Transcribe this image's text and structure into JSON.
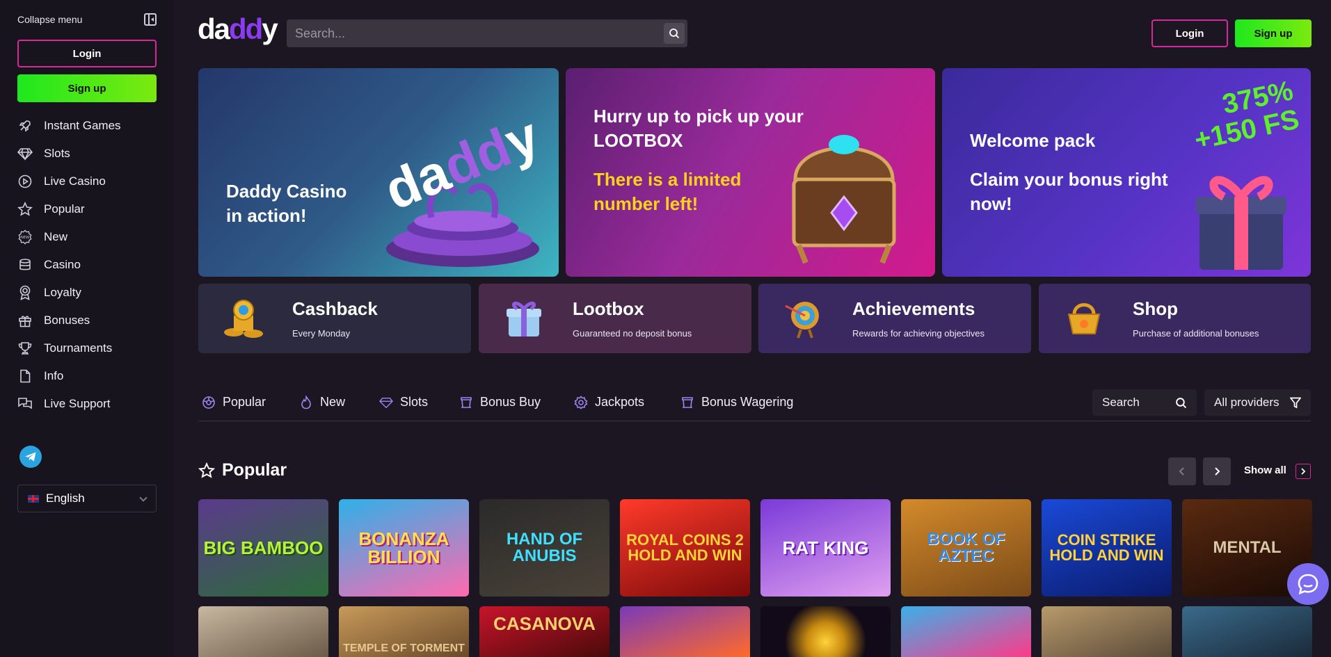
{
  "sidebar": {
    "collapse_label": "Collapse menu",
    "login": "Login",
    "signup": "Sign up",
    "items": [
      {
        "label": "Instant Games",
        "icon": "rocket-icon"
      },
      {
        "label": "Slots",
        "icon": "diamond-icon"
      },
      {
        "label": "Live Casino",
        "icon": "play-icon"
      },
      {
        "label": "Popular",
        "icon": "star-icon"
      },
      {
        "label": "New",
        "icon": "new-badge-icon"
      },
      {
        "label": "Casino",
        "icon": "database-icon"
      },
      {
        "label": "Loyalty",
        "icon": "award-icon"
      },
      {
        "label": "Bonuses",
        "icon": "gift-icon"
      },
      {
        "label": "Tournaments",
        "icon": "trophy-icon"
      },
      {
        "label": "Info",
        "icon": "document-icon"
      },
      {
        "label": "Live Support",
        "icon": "chat-icon"
      }
    ],
    "language": "English"
  },
  "header": {
    "logo": {
      "part1": "da",
      "part2": "dd",
      "part3": "y"
    },
    "search_placeholder": "Search...",
    "login": "Login",
    "signup": "Sign up"
  },
  "banners": [
    {
      "title": "Daddy Casino in action!"
    },
    {
      "title": "Hurry up to pick up your LOOTBOX",
      "highlight": "There is a limited number left!"
    },
    {
      "title": "Welcome pack",
      "subtitle": "Claim your bonus right now!",
      "badge_line1": "375%",
      "badge_line2": "+150 FS"
    }
  ],
  "cards": [
    {
      "title": "Cashback",
      "subtitle": "Every Monday"
    },
    {
      "title": "Lootbox",
      "subtitle": "Guaranteed no deposit bonus"
    },
    {
      "title": "Achievements",
      "subtitle": "Rewards for achieving objectives"
    },
    {
      "title": "Shop",
      "subtitle": "Purchase of additional bonuses"
    }
  ],
  "categories": [
    {
      "label": "Popular"
    },
    {
      "label": "New"
    },
    {
      "label": "Slots"
    },
    {
      "label": "Bonus Buy"
    },
    {
      "label": "Jackpots"
    },
    {
      "label": "Bonus Wagering"
    }
  ],
  "category_search": "Search",
  "providers": "All providers",
  "popular": {
    "title": "Popular",
    "show_all": "Show all",
    "games": [
      {
        "name": "BIG BAMBOO"
      },
      {
        "name": "BONANZA BILLION"
      },
      {
        "name": "HAND OF ANUBIS"
      },
      {
        "name": "ROYAL COINS 2 HOLD AND WIN"
      },
      {
        "name": "RAT KING"
      },
      {
        "name": "BOOK OF AZTEC"
      },
      {
        "name": "COIN STRIKE HOLD AND WIN"
      },
      {
        "name": "MENTAL"
      }
    ],
    "games_row2": [
      {
        "name": ""
      },
      {
        "name": "TEMPLE OF TORMENT"
      },
      {
        "name": "CASANOVA"
      },
      {
        "name": ""
      },
      {
        "name": ""
      },
      {
        "name": ""
      },
      {
        "name": ""
      },
      {
        "name": ""
      }
    ]
  },
  "colors": {
    "accent_pink": "#d62a9c",
    "signup_green": "#1ee81e",
    "brand_purple": "#8b3bf0",
    "highlight_yellow": "#ffd21a"
  }
}
